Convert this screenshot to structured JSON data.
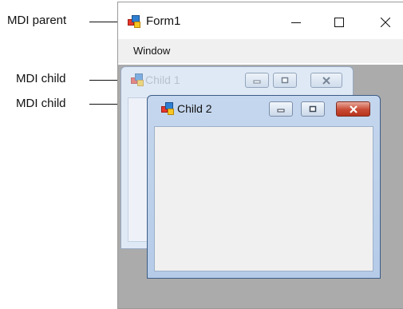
{
  "annotations": {
    "parent_label": "MDI parent",
    "child_label_1": "MDI child",
    "child_label_2": "MDI child"
  },
  "parent": {
    "title": "Form1",
    "menu": [
      "Window"
    ],
    "icon": "windows-form-icon",
    "controls": [
      "minimize-icon",
      "maximize-icon",
      "close-icon"
    ]
  },
  "children": [
    {
      "title": "Child 1",
      "state": "inactive",
      "icon": "windows-form-icon"
    },
    {
      "title": "Child 2",
      "state": "active",
      "icon": "windows-form-icon"
    }
  ],
  "colors": {
    "client_area": "#ababab",
    "active_child_frame": "#b5cbe8",
    "close_button_active": "#c84a34"
  }
}
